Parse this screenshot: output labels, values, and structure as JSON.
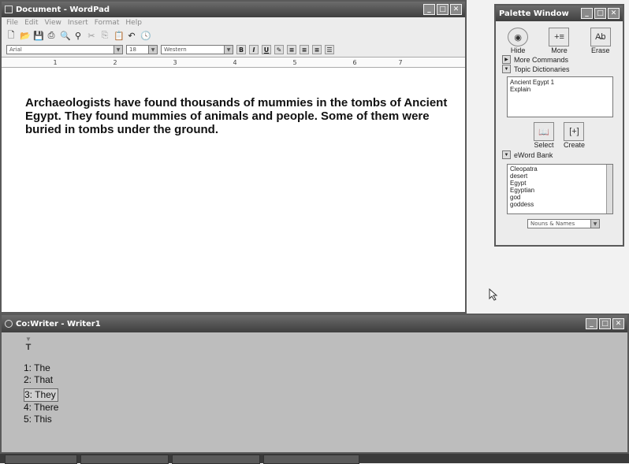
{
  "wordpad": {
    "title": "Document - WordPad",
    "menu": [
      "File",
      "Edit",
      "View",
      "Insert",
      "Format",
      "Help"
    ],
    "font_name": "Arial",
    "font_size": "18",
    "script": "Western",
    "ruler_marks": [
      "1",
      "2",
      "3",
      "4",
      "5",
      "6",
      "7"
    ],
    "body_text": "Archaeologists have found  thousands of mummies in the tombs of Ancient Egypt. They found mummies of animals and people. Some of them were buried in tombs under the ground."
  },
  "palette": {
    "title": "Palette Window",
    "buttons": [
      "Hide",
      "More",
      "Erase"
    ],
    "more_commands": "More Commands",
    "topic_dictionaries": "Topic Dictionaries",
    "topics": [
      "Ancient Egypt 1",
      "Explain"
    ],
    "select_label": "Select",
    "create_label": "Create",
    "word_bank_label": "eWord Bank",
    "words": [
      "Cleopatra",
      "desert",
      "Egypt",
      "Egyptian",
      "god",
      "goddess"
    ],
    "filter": "Nouns & Names"
  },
  "cowriter": {
    "title": "Co:Writer - Writer1",
    "prefix": "T",
    "predictions": [
      "1: The",
      "2: That",
      "3: They",
      "4: There",
      "5: This"
    ]
  }
}
